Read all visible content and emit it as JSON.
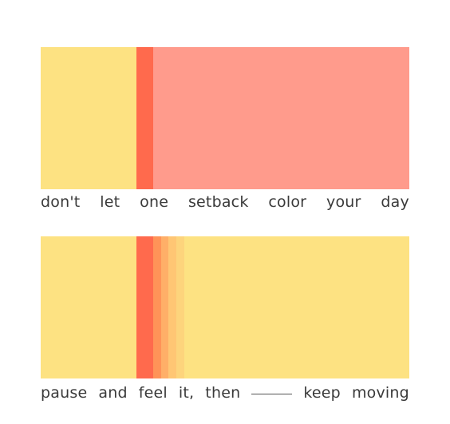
{
  "colors": {
    "background": "#ffffff",
    "yellow": "#fde282",
    "coral": "#ff6a4d",
    "salmon": "#ff9b8c",
    "peach_1": "#ff9358",
    "peach_2": "#ffaf68",
    "peach_3": "#ffc674",
    "peach_4": "#fdd47c",
    "text": "#3a3a3a"
  },
  "panel_1": {
    "caption_words": [
      "don't",
      "let",
      "one",
      "setback",
      "color",
      "your",
      "day"
    ]
  },
  "panel_2": {
    "caption_words": [
      "pause",
      "and",
      "feel",
      "it,",
      "then",
      "keep",
      "moving"
    ]
  }
}
